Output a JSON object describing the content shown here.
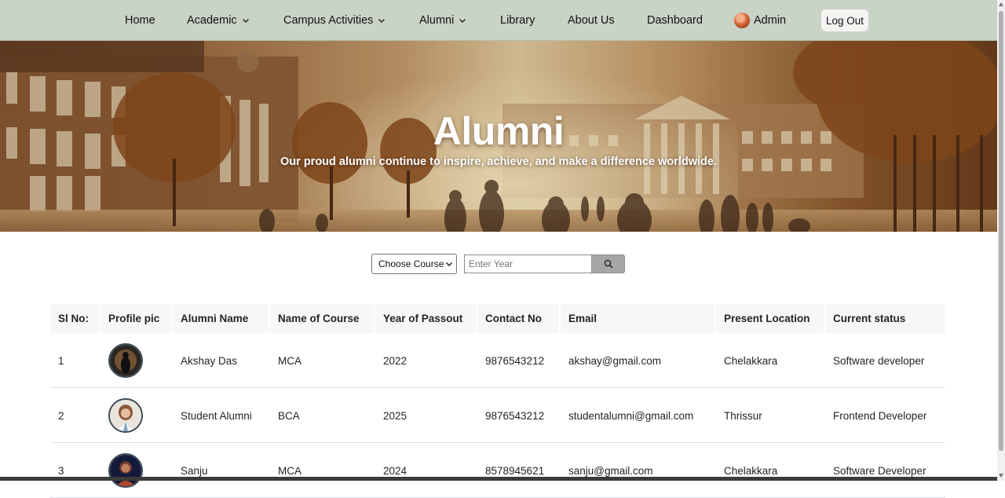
{
  "nav": {
    "home": "Home",
    "academic": "Academic",
    "campus_activities": "Campus Activities",
    "alumni": "Alumni",
    "library": "Library",
    "about_us": "About Us",
    "dashboard": "Dashboard",
    "admin": "Admin",
    "logout": "Log Out"
  },
  "hero": {
    "title": "Alumni",
    "subtitle": "Our proud alumni continue to inspire, achieve, and make a difference worldwide."
  },
  "filter": {
    "course_selected": "Choose Course",
    "year_placeholder": "Enter Year",
    "search_icon": "search-icon"
  },
  "table": {
    "headers": [
      "Sl No:",
      "Profile pic",
      "Alumni Name",
      "Name of Course",
      "Year of Passout",
      "Contact No",
      "Email",
      "Present Location",
      "Current status"
    ],
    "rows": [
      {
        "sl": "1",
        "name": "Akshay Das",
        "course": "MCA",
        "year": "2022",
        "contact": "9876543212",
        "email": "akshay@gmail.com",
        "location": "Chelakkara",
        "status": "Software developer"
      },
      {
        "sl": "2",
        "name": "Student Alumni",
        "course": "BCA",
        "year": "2025",
        "contact": "9876543212",
        "email": "studentalumni@gmail.com",
        "location": "Thrissur",
        "status": "Frontend Developer"
      },
      {
        "sl": "3",
        "name": "Sanju",
        "course": "MCA",
        "year": "2024",
        "contact": "8578945621",
        "email": "sanju@gmail.com",
        "location": "Chelakkara",
        "status": "Software Developer"
      }
    ]
  },
  "colors": {
    "navbar_bg": "#c9d3c6",
    "header_cell_bg": "#f7f7f7",
    "search_button_bg": "#a6a6a6"
  }
}
